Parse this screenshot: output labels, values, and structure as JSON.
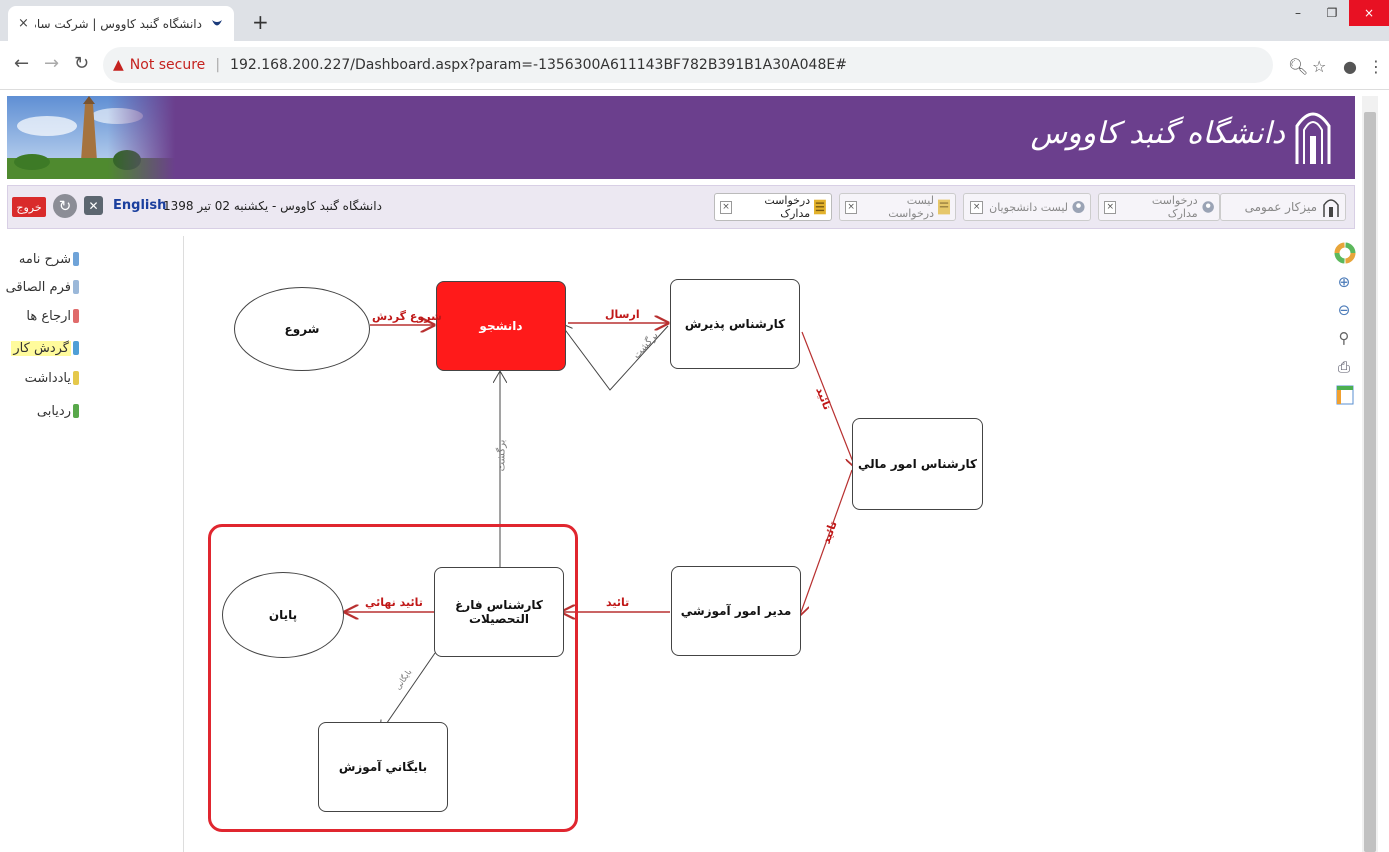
{
  "browser": {
    "tab_title": "دانشگاه گنبد کاووس | شرکت سامان",
    "tab_close": "×",
    "new_tab": "+",
    "security_label": "Not secure",
    "url": "192.168.200.227/Dashboard.aspx?param=-1356300A611143BF782B391B1A30A048E#",
    "window_controls": [
      "–",
      "❐",
      "×"
    ]
  },
  "banner": {
    "university_name": "دانشگاه گنبد کاووس"
  },
  "toolbar": {
    "exit_label": "خروج",
    "language_label": "English",
    "date_text": "دانشگاه گنبد کاووس - یکشنبه 02 تیر 1398",
    "tabs": [
      {
        "label": "میزکار عمومی",
        "active": false
      },
      {
        "label": "درخواست مدارک",
        "active": false
      },
      {
        "label": "لیست دانشجویان",
        "active": false
      },
      {
        "label": "لیست درخواست",
        "active": false
      },
      {
        "label": "درخواست مدارک",
        "active": true
      }
    ]
  },
  "side_menu": {
    "items": [
      {
        "label": "شرح نامه",
        "color": "#6fa3d8"
      },
      {
        "label": "فرم الصاقی",
        "color": "#9bb8d9"
      },
      {
        "label": "ارجاع ها",
        "color": "#e06b6b"
      },
      {
        "label": "گردش کار",
        "color": "#4f9fd6",
        "active": true
      },
      {
        "label": "یادداشت",
        "color": "#e5c84b"
      },
      {
        "label": "ردیابی",
        "color": "#58a84a"
      }
    ]
  },
  "diagram": {
    "nodes": {
      "start": "شروع",
      "student": "دانشجو",
      "admission": "کارشناس پذیرش",
      "finance": "کارشناس امور مالي",
      "edu_manager": "مدیر امور آموزشي",
      "graduates": "کارشناس فارغ التحصيلات",
      "end": "پایان",
      "archive": "بايگاني آموزش"
    },
    "edges": {
      "start_flow": "شروع گردش",
      "send": "ارسال",
      "return_top": "برگشت",
      "approve1": "تائید",
      "approve2": "تائید",
      "approve3": "تائید",
      "final_approve": "تائید نهائي",
      "return_left": "برگشت",
      "archive_edge": "بایگانی"
    }
  },
  "colors": {
    "banner": "#6b3f8d",
    "current_node": "#ff1a1a",
    "edge": "#b83030",
    "highlight": "#e0262f"
  }
}
